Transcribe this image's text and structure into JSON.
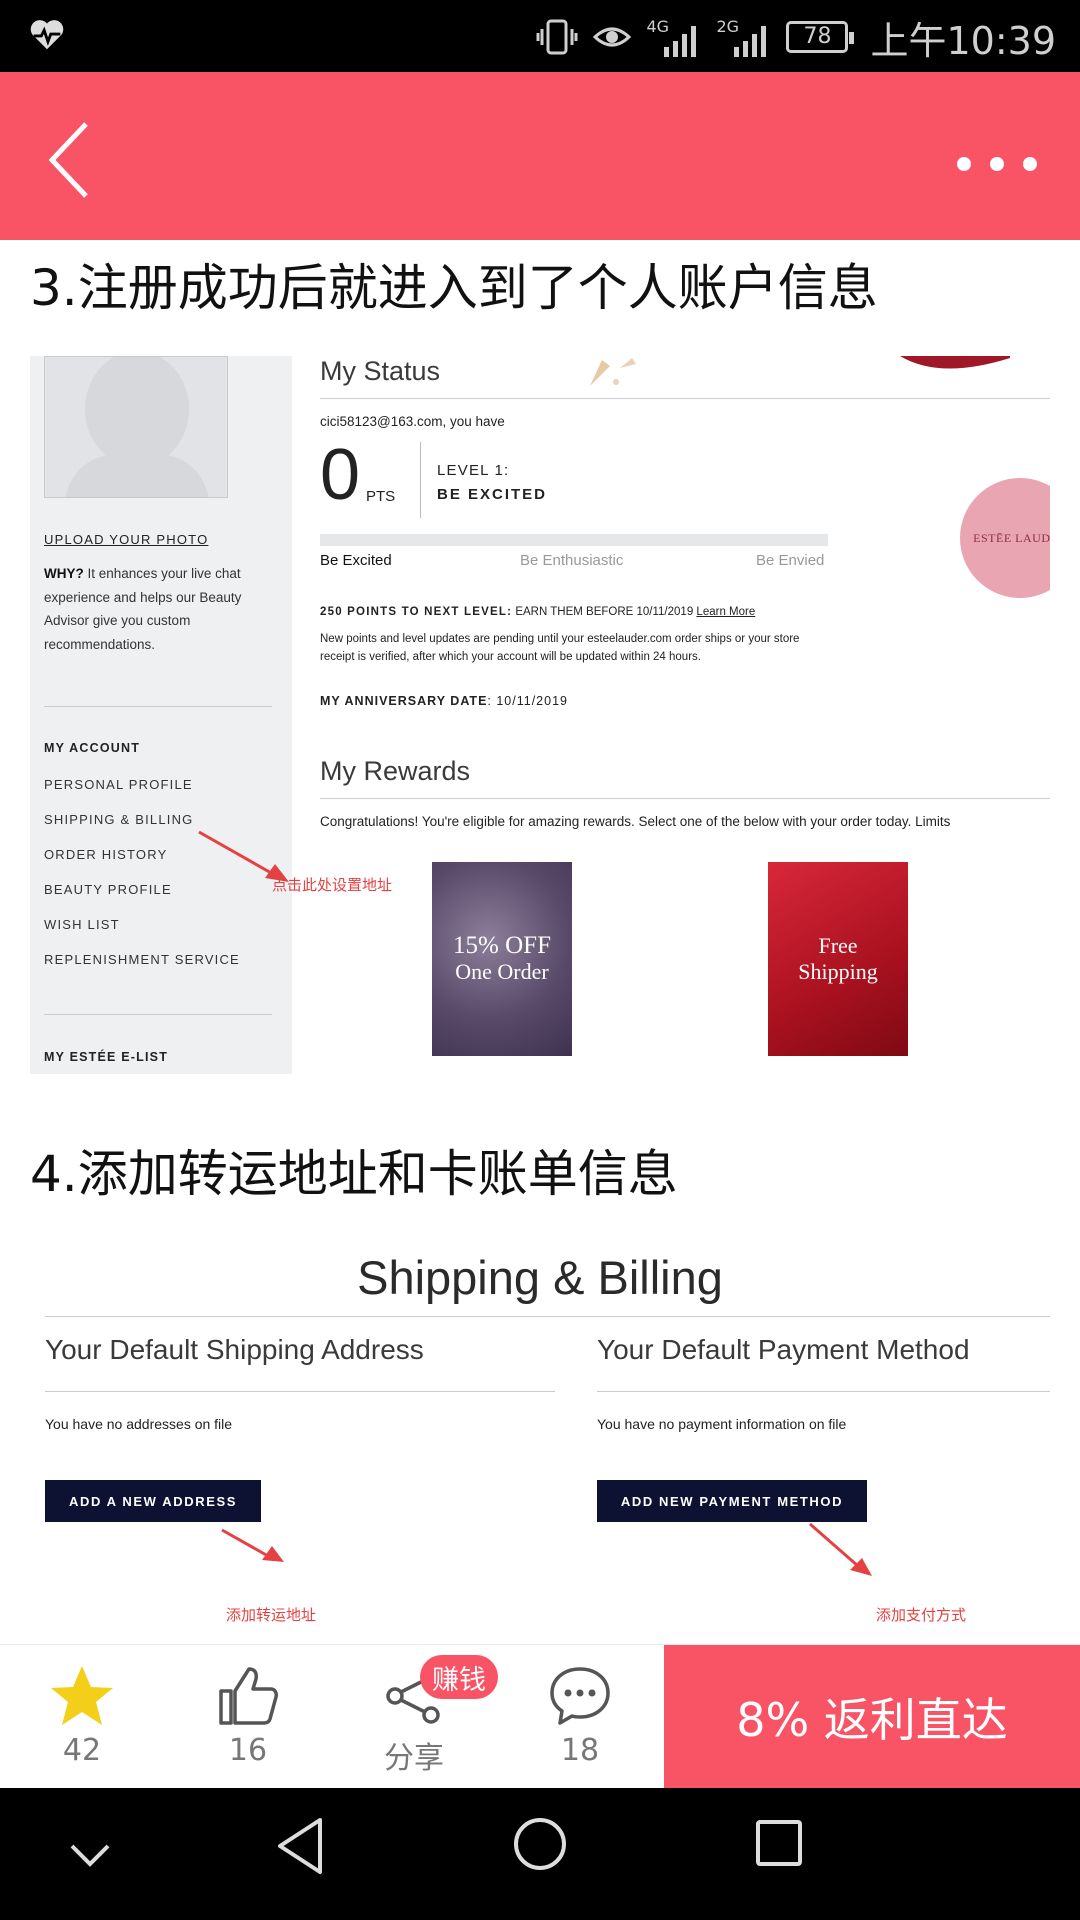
{
  "status_bar": {
    "network_4g": "4G",
    "network_2g": "2G",
    "battery": "78",
    "time": "上午10:39"
  },
  "article": {
    "step3_title": "3.注册成功后就进入到了个人账户信息",
    "step4_title": "4.添加转运地址和卡账单信息"
  },
  "screenshot1": {
    "sidebar": {
      "upload_link": "UPLOAD YOUR PHOTO",
      "why_label": "WHY?",
      "why_text": "It enhances your live chat experience and helps our Beauty Advisor give you custom recommendations.",
      "my_account_title": "MY ACCOUNT",
      "menu": [
        "PERSONAL PROFILE",
        "SHIPPING & BILLING",
        "ORDER HISTORY",
        "BEAUTY PROFILE",
        "WISH LIST",
        "REPLENISHMENT SERVICE"
      ],
      "elist_title": "MY ESTÉE E-LIST"
    },
    "status": {
      "heading": "My Status",
      "email_line": "cici58123@163.com, you have",
      "points": "0",
      "points_unit": "PTS",
      "level_label": "LEVEL 1:",
      "level_name": "BE EXCITED",
      "progress_fraction": 0.0,
      "levels": [
        "Be Excited",
        "Be Enthusiastic",
        "Be Envied"
      ],
      "next_level_bold": "250 POINTS TO NEXT LEVEL:",
      "next_level_text": "EARN THEM BEFORE 10/11/2019",
      "learn_more": "Learn More",
      "pending_note": "New points and level updates are pending until your esteelauder.com order ships or your store receipt is verified, after which your account will be updated within 24 hours.",
      "anniversary_label": "MY ANNIVERSARY DATE",
      "anniversary_date": ": 10/11/2019",
      "brand_logo": "ESTĒE LAUDER"
    },
    "rewards": {
      "heading": "My Rewards",
      "intro": "Congratulations! You're eligible for amazing rewards. Select one of the below with your order today. Limits",
      "offer1_line1": "15% OFF",
      "offer1_line2": "One Order",
      "offer2_line1": "Free",
      "offer2_line2": "Shipping"
    },
    "annotation": "点击此处设置地址"
  },
  "screenshot2": {
    "title": "Shipping & Billing",
    "shipping_heading": "Your Default Shipping Address",
    "shipping_empty": "You have no addresses on file",
    "add_address_btn": "ADD A NEW ADDRESS",
    "payment_heading": "Your Default Payment Method",
    "payment_empty": "You have no payment information on file",
    "add_payment_btn": "ADD NEW PAYMENT METHOD",
    "annotation_address": "添加转运地址",
    "annotation_payment": "添加支付方式"
  },
  "bottom_bar": {
    "favorite_count": "42",
    "like_count": "16",
    "share_label": "分享",
    "earn_badge": "赚钱",
    "comment_count": "18",
    "cta": "8% 返利直达"
  },
  "colors": {
    "accent": "#f95366",
    "dark_button": "#0e1232",
    "annotation": "#e44242",
    "star": "#f3cf1a"
  }
}
